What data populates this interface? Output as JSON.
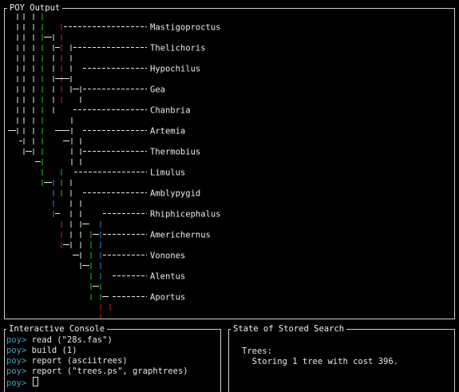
{
  "output_panel": {
    "title": "POY Output"
  },
  "console_panel": {
    "title": "Interactive Console",
    "prompt": "poy>",
    "lines": [
      "read (\"28s.fas\")",
      "build (1)",
      "report (asciitrees)",
      "report (\"trees.ps\", graphtrees)",
      ""
    ]
  },
  "state_panel": {
    "title": "State of Stored Search",
    "heading": "Trees:",
    "status": "Storing 1 tree with cost 396."
  },
  "tree": {
    "taxa": [
      "Mastigoproctus",
      "Thelichoris",
      "Hypochilus",
      "Gea",
      "Chanbria",
      "Artemia",
      "Thermobius",
      "Limulus",
      "Amblypygid",
      "Rhiphicephalus",
      "Americhernus",
      "Vonones",
      "Alentus",
      "Aportus"
    ],
    "colors": {
      "white": "#e6e6e6",
      "green": "#22c422",
      "red": "#d21e1e",
      "blue": "#2f86d8"
    }
  }
}
